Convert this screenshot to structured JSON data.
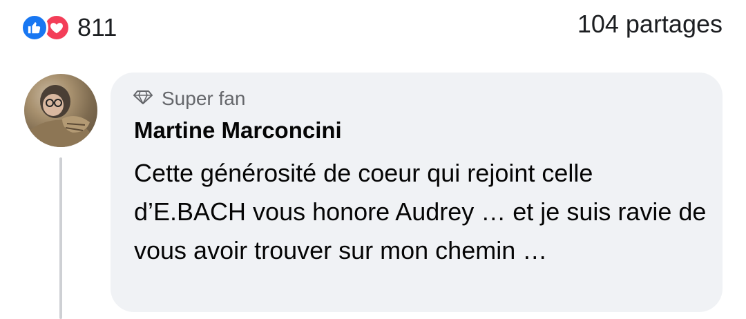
{
  "reactions": {
    "icons": [
      "thumbs-up-icon",
      "heart-icon"
    ],
    "count": "811",
    "colors": {
      "like": "#1877f2",
      "love": "#f33e58"
    }
  },
  "shares": {
    "label": "104 partages"
  },
  "comment": {
    "badge_icon": "diamond-icon",
    "badge_label": "Super fan",
    "author": "Martine Marconcini",
    "text": "Cette générosité de coeur qui rejoint celle d’E.BACH vous honore Audrey … et je suis ravie de vous avoir trouver sur mon chemin …",
    "bubble_color": "#f0f2f5"
  }
}
